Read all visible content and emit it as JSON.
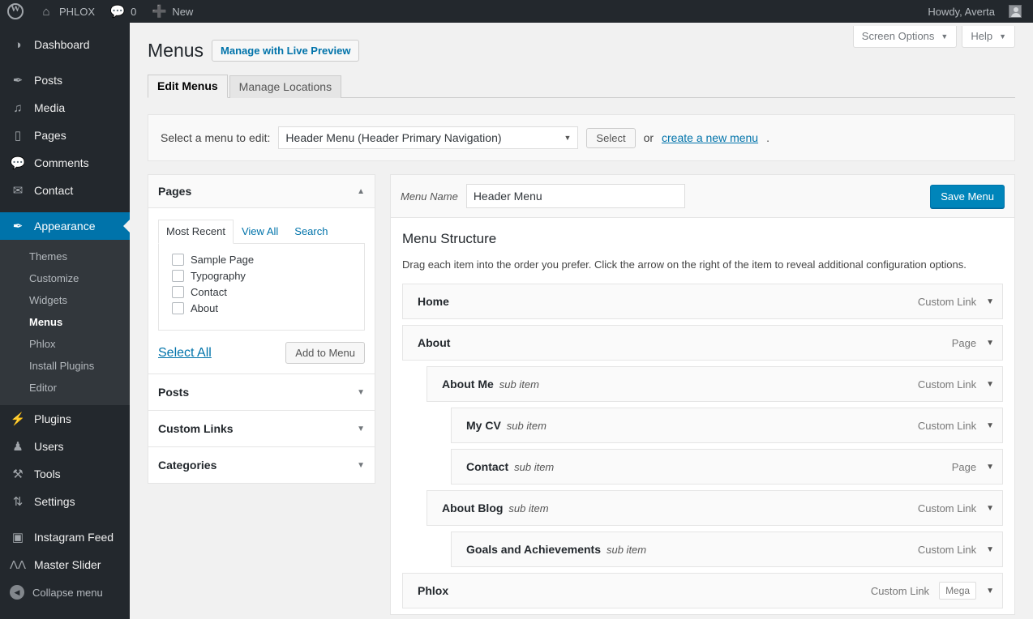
{
  "adminbar": {
    "logo_icon": "wordpress-logo-icon",
    "site_name": "PHLOX",
    "home_icon": "home-icon",
    "comments_icon": "comment-bubble-icon",
    "comments_count": "0",
    "new_icon": "plus-icon",
    "new_label": "New",
    "howdy": "Howdy, Averta",
    "avatar_icon": "user-avatar-icon"
  },
  "sidebar": {
    "items": [
      {
        "label": "Dashboard",
        "icon": "dashboard-gauge-icon",
        "glyph": "◔"
      },
      {
        "label": "Posts",
        "icon": "pin-icon",
        "glyph": "✐"
      },
      {
        "label": "Media",
        "icon": "media-music-icon",
        "glyph": "♫"
      },
      {
        "label": "Pages",
        "icon": "pages-icon",
        "glyph": "▯"
      },
      {
        "label": "Comments",
        "icon": "comment-bubble-icon",
        "glyph": "▬"
      },
      {
        "label": "Contact",
        "icon": "envelope-icon",
        "glyph": "✉"
      },
      {
        "label": "Appearance",
        "icon": "paint-brush-icon",
        "glyph": "✎",
        "active": true
      }
    ],
    "submenu": [
      {
        "label": "Themes"
      },
      {
        "label": "Customize"
      },
      {
        "label": "Widgets"
      },
      {
        "label": "Menus",
        "current": true
      },
      {
        "label": "Phlox"
      },
      {
        "label": "Install Plugins"
      },
      {
        "label": "Editor"
      }
    ],
    "items_after": [
      {
        "label": "Plugins",
        "icon": "plug-icon",
        "glyph": "⚡"
      },
      {
        "label": "Users",
        "icon": "user-icon",
        "glyph": "♟"
      },
      {
        "label": "Tools",
        "icon": "wrench-icon",
        "glyph": "⚒"
      },
      {
        "label": "Settings",
        "icon": "sliders-icon",
        "glyph": "⇅"
      }
    ],
    "plugin_items": [
      {
        "label": "Instagram Feed",
        "icon": "camera-icon",
        "glyph": "▣"
      },
      {
        "label": "Master Slider",
        "icon": "master-slider-icon",
        "glyph": "Μ"
      }
    ],
    "collapse_label": "Collapse menu",
    "collapse_icon": "collapse-arrow-icon"
  },
  "screen_meta": {
    "screen_options_label": "Screen Options",
    "help_label": "Help",
    "caret_icon": "chevron-down-icon"
  },
  "header": {
    "title": "Menus",
    "live_preview_label": "Manage with Live Preview"
  },
  "tabs": [
    {
      "label": "Edit Menus",
      "active": true
    },
    {
      "label": "Manage Locations",
      "active": false
    }
  ],
  "select_bar": {
    "label": "Select a menu to edit:",
    "selected_menu": "Header Menu (Header Primary Navigation)",
    "dropdown_icon": "chevron-down-icon",
    "select_button": "Select",
    "or_text": "or",
    "create_link": "create a new menu",
    "period": "."
  },
  "left_panels": {
    "pages": {
      "title": "Pages",
      "toggle_icon": "chevron-up-icon",
      "tabs": [
        {
          "label": "Most Recent",
          "active": true
        },
        {
          "label": "View All",
          "active": false
        },
        {
          "label": "Search",
          "active": false
        }
      ],
      "checkboxes": [
        {
          "label": "Sample Page",
          "checked": false
        },
        {
          "label": "Typography",
          "checked": false
        },
        {
          "label": "Contact",
          "checked": false
        },
        {
          "label": "About",
          "checked": false
        }
      ],
      "select_all": "Select All",
      "add_to_menu": "Add to Menu"
    },
    "collapsed": [
      {
        "title": "Posts",
        "toggle_icon": "chevron-down-icon"
      },
      {
        "title": "Custom Links",
        "toggle_icon": "chevron-down-icon"
      },
      {
        "title": "Categories",
        "toggle_icon": "chevron-down-icon"
      }
    ]
  },
  "menu_editor": {
    "name_label": "Menu Name",
    "name_value": "Header Menu",
    "name_placeholder": "Menu Name",
    "save_label": "Save Menu",
    "structure_title": "Menu Structure",
    "structure_desc": "Drag each item into the order you prefer. Click the arrow on the right of the item to reveal additional configuration options.",
    "items": [
      {
        "title": "Home",
        "sub": "",
        "type": "Custom Link",
        "depth": 0,
        "badge": ""
      },
      {
        "title": "About",
        "sub": "",
        "type": "Page",
        "depth": 0,
        "badge": ""
      },
      {
        "title": "About Me",
        "sub": "sub item",
        "type": "Custom Link",
        "depth": 1,
        "badge": ""
      },
      {
        "title": "My CV",
        "sub": "sub item",
        "type": "Custom Link",
        "depth": 2,
        "badge": ""
      },
      {
        "title": "Contact",
        "sub": "sub item",
        "type": "Page",
        "depth": 2,
        "badge": ""
      },
      {
        "title": "About Blog",
        "sub": "sub item",
        "type": "Custom Link",
        "depth": 1,
        "badge": ""
      },
      {
        "title": "Goals and Achievements",
        "sub": "sub item",
        "type": "Custom Link",
        "depth": 2,
        "badge": ""
      },
      {
        "title": "Phlox",
        "sub": "",
        "type": "Custom Link",
        "depth": 0,
        "badge": "Mega"
      }
    ],
    "item_caret_icon": "chevron-down-icon"
  },
  "colors": {
    "admin_dark": "#23282d",
    "admin_submenu": "#32373c",
    "accent_blue": "#0073aa",
    "button_blue": "#0085ba",
    "page_bg": "#f1f1f1"
  }
}
